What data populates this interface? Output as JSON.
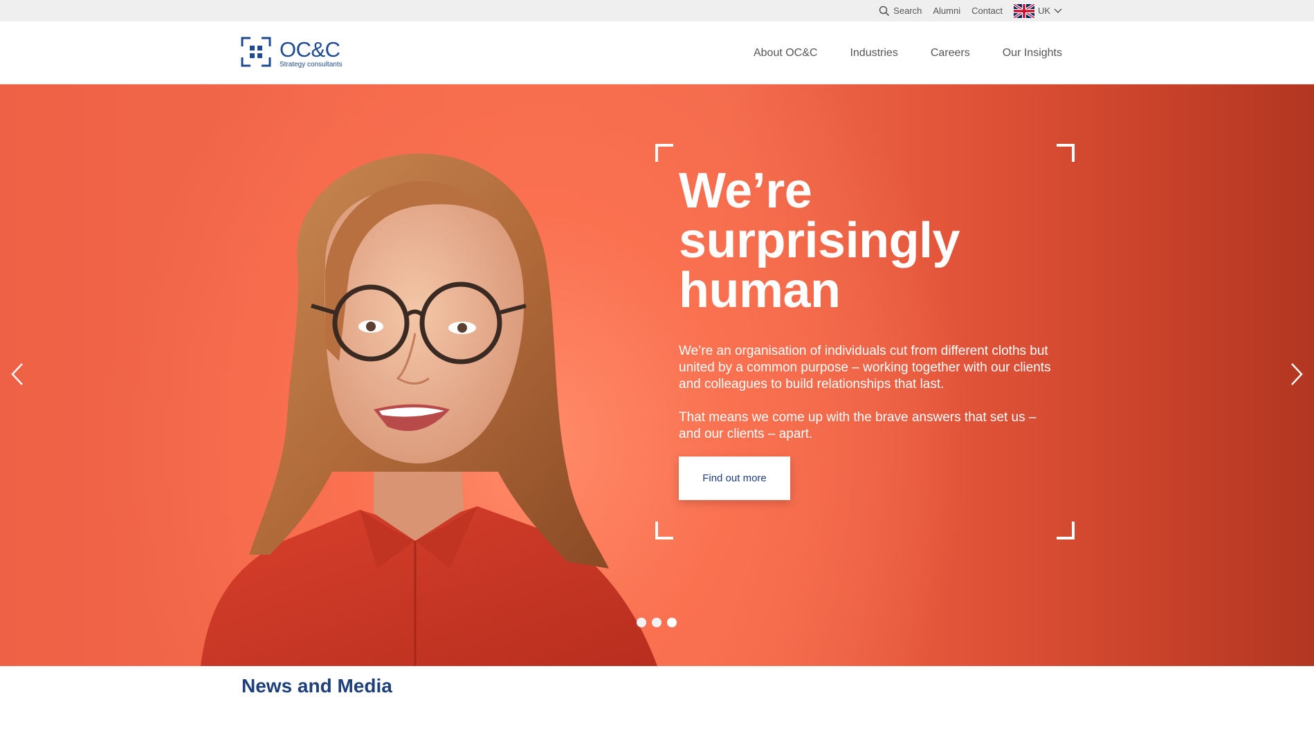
{
  "utility": {
    "search_label": "Search",
    "alumni_label": "Alumni",
    "contact_label": "Contact",
    "region_label": "UK"
  },
  "brand": {
    "name": "OC&C",
    "tagline": "Strategy consultants",
    "color": "#1e4a94"
  },
  "nav": {
    "items": [
      {
        "label": "About OC&C"
      },
      {
        "label": "Industries"
      },
      {
        "label": "Careers"
      },
      {
        "label": "Our Insights"
      }
    ]
  },
  "hero": {
    "title_lines": [
      "We’re",
      "surprisingly",
      "human"
    ],
    "paragraph_1": "We’re an organisation of individuals cut from different cloths but united by a common purpose – working together with our clients and colleagues to build relationships that last.",
    "paragraph_2": "That means we come up with the brave answers that set us – and our clients – apart.",
    "cta_label": "Find out more",
    "slide_count": 3,
    "active_slide": 3
  },
  "news": {
    "title": "News and Media"
  },
  "icons": {
    "search": "search-icon",
    "flag": "uk-flag-icon",
    "chevron": "chevron-down-icon",
    "prev": "chevron-left-icon",
    "next": "chevron-right-icon"
  }
}
